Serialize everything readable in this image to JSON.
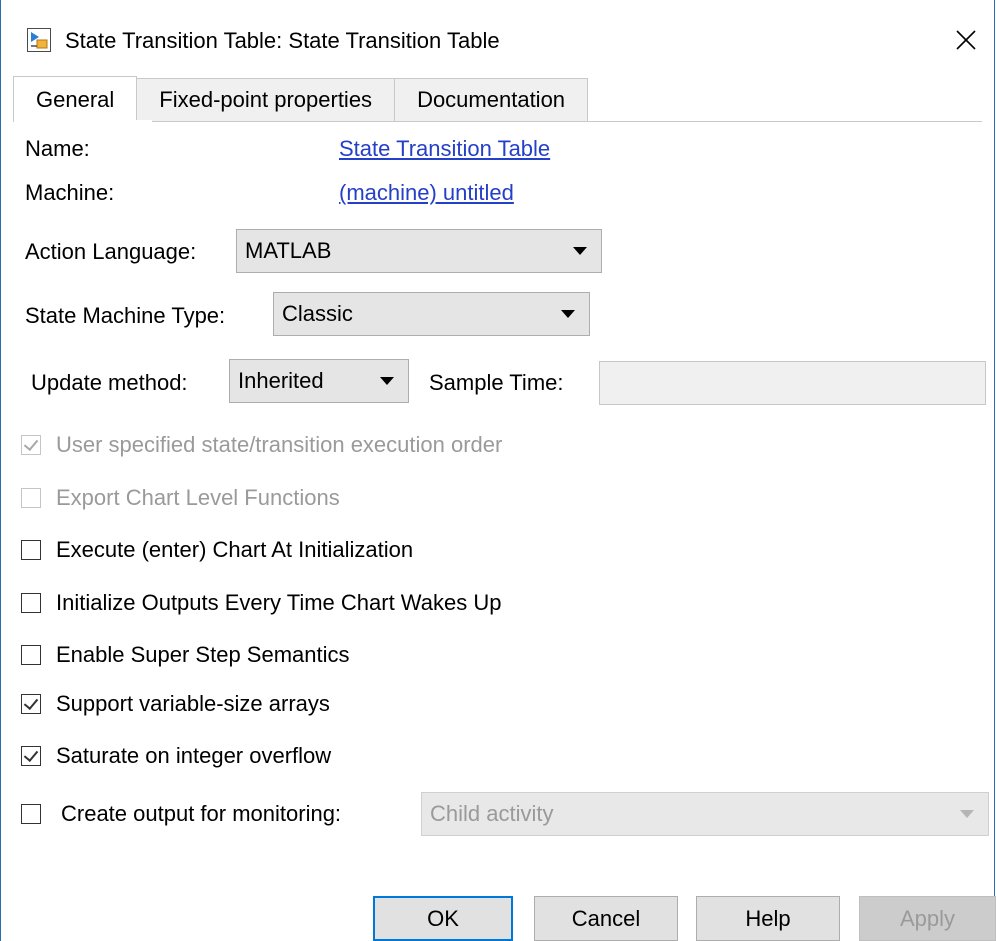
{
  "window": {
    "title": "State Transition Table: State Transition Table",
    "app_icon": "simulink-stateflow-icon",
    "close_icon": "close-icon"
  },
  "tabs": [
    {
      "label": "General",
      "active": true
    },
    {
      "label": "Fixed-point properties",
      "active": false
    },
    {
      "label": "Documentation",
      "active": false
    }
  ],
  "general": {
    "name_label": "Name:",
    "name_value": "State Transition Table",
    "machine_label": "Machine:",
    "machine_value": "(machine) untitled",
    "action_language_label": "Action Language:",
    "action_language_value": "MATLAB",
    "state_machine_type_label": "State Machine Type:",
    "state_machine_type_value": "Classic",
    "update_method_label": "Update method:",
    "update_method_value": "Inherited",
    "sample_time_label": "Sample Time:",
    "sample_time_value": ""
  },
  "checkboxes": [
    {
      "label": "User specified state/transition execution order",
      "checked": true,
      "disabled": true
    },
    {
      "label": "Export Chart Level Functions",
      "checked": false,
      "disabled": true
    },
    {
      "label": "Execute (enter) Chart At Initialization",
      "checked": false,
      "disabled": false
    },
    {
      "label": "Initialize Outputs Every Time Chart Wakes Up",
      "checked": false,
      "disabled": false
    },
    {
      "label": "Enable Super Step Semantics",
      "checked": false,
      "disabled": false
    },
    {
      "label": "Support variable-size arrays",
      "checked": true,
      "disabled": false
    },
    {
      "label": "Saturate on integer overflow",
      "checked": true,
      "disabled": false
    }
  ],
  "monitoring": {
    "label": "Create output for monitoring:",
    "checked": false,
    "value": "Child activity",
    "disabled": true
  },
  "buttons": {
    "ok": "OK",
    "cancel": "Cancel",
    "help": "Help",
    "apply": "Apply"
  },
  "colors": {
    "link": "#2440c8",
    "default_button_border": "#0078d7",
    "window_border": "#2b6cb0"
  }
}
